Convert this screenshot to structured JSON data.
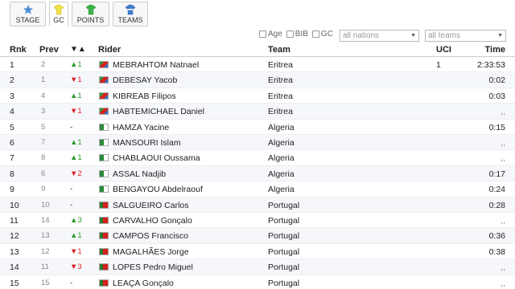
{
  "tabs": [
    {
      "label": "STAGE",
      "icon": "star-icon",
      "color": "#4a90d9"
    },
    {
      "label": "GC",
      "icon": "yellow-jersey-icon",
      "color": "#f0e04a"
    },
    {
      "label": "POINTS",
      "icon": "green-jersey-icon",
      "color": "#3cb44a"
    },
    {
      "label": "TEAMS",
      "icon": "team-jersey-icon",
      "color": "#3d7fd0"
    }
  ],
  "filters": {
    "age_label": "Age",
    "bib_label": "BIB",
    "gc_label": "GC",
    "nations_value": "all nations",
    "teams_value": "all teams"
  },
  "columns": {
    "rnk": "Rnk",
    "prev": "Prev",
    "diff": "▼▲",
    "rider": "Rider",
    "team": "Team",
    "uci": "UCI",
    "time": "Time"
  },
  "rows": [
    {
      "rnk": "1",
      "prev": "2",
      "diff": "▲1",
      "dir": "up",
      "flag": "eri",
      "rider": "MEBRAHTOM Natnael",
      "team": "Eritrea",
      "uci": "1",
      "time": "2:33:53"
    },
    {
      "rnk": "2",
      "prev": "1",
      "diff": "▼1",
      "dir": "down",
      "flag": "eri",
      "rider": "DEBESAY Yacob",
      "team": "Eritrea",
      "uci": "",
      "time": "0:02"
    },
    {
      "rnk": "3",
      "prev": "4",
      "diff": "▲1",
      "dir": "up",
      "flag": "eri",
      "rider": "KIBREAB Filipos",
      "team": "Eritrea",
      "uci": "",
      "time": "0:03"
    },
    {
      "rnk": "4",
      "prev": "3",
      "diff": "▼1",
      "dir": "down",
      "flag": "eri",
      "rider": "HABTEMICHAEL Daniel",
      "team": "Eritrea",
      "uci": "",
      "time": ",,"
    },
    {
      "rnk": "5",
      "prev": "5",
      "diff": "-",
      "dir": "same",
      "flag": "alg",
      "rider": "HAMZA Yacine",
      "team": "Algeria",
      "uci": "",
      "time": "0:15"
    },
    {
      "rnk": "6",
      "prev": "7",
      "diff": "▲1",
      "dir": "up",
      "flag": "alg",
      "rider": "MANSOURI Islam",
      "team": "Algeria",
      "uci": "",
      "time": ",,"
    },
    {
      "rnk": "7",
      "prev": "8",
      "diff": "▲1",
      "dir": "up",
      "flag": "alg",
      "rider": "CHABLAOUI Oussama",
      "team": "Algeria",
      "uci": "",
      "time": ",,"
    },
    {
      "rnk": "8",
      "prev": "6",
      "diff": "▼2",
      "dir": "down",
      "flag": "alg",
      "rider": "ASSAL Nadjib",
      "team": "Algeria",
      "uci": "",
      "time": "0:17"
    },
    {
      "rnk": "9",
      "prev": "9",
      "diff": "-",
      "dir": "same",
      "flag": "alg",
      "rider": "BENGAYOU Abdelraouf",
      "team": "Algeria",
      "uci": "",
      "time": "0:24"
    },
    {
      "rnk": "10",
      "prev": "10",
      "diff": "-",
      "dir": "same",
      "flag": "por",
      "rider": "SALGUEIRO Carlos",
      "team": "Portugal",
      "uci": "",
      "time": "0:28"
    },
    {
      "rnk": "11",
      "prev": "14",
      "diff": "▲3",
      "dir": "up",
      "flag": "por",
      "rider": "CARVALHO Gonçalo",
      "team": "Portugal",
      "uci": "",
      "time": ",,"
    },
    {
      "rnk": "12",
      "prev": "13",
      "diff": "▲1",
      "dir": "up",
      "flag": "por",
      "rider": "CAMPOS Francisco",
      "team": "Portugal",
      "uci": "",
      "time": "0:36"
    },
    {
      "rnk": "13",
      "prev": "12",
      "diff": "▼1",
      "dir": "down",
      "flag": "por",
      "rider": "MAGALHÃES Jorge",
      "team": "Portugal",
      "uci": "",
      "time": "0:38"
    },
    {
      "rnk": "14",
      "prev": "11",
      "diff": "▼3",
      "dir": "down",
      "flag": "por",
      "rider": "LOPES Pedro Miguel",
      "team": "Portugal",
      "uci": "",
      "time": ",,"
    },
    {
      "rnk": "15",
      "prev": "15",
      "diff": "-",
      "dir": "same",
      "flag": "por",
      "rider": "LEAÇA Gonçalo",
      "team": "Portugal",
      "uci": "",
      "time": ",,"
    }
  ]
}
